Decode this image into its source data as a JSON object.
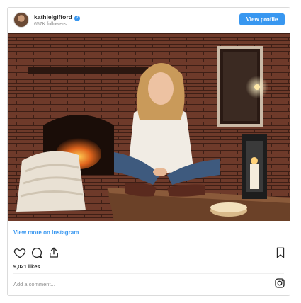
{
  "header": {
    "username": "kathielgifford",
    "verified_mark": "✓",
    "followers": "657K followers",
    "view_profile_label": "View profile"
  },
  "post": {
    "view_more_label": "View more on Instagram",
    "likes": "9,021 likes",
    "comment_placeholder": "Add a comment..."
  },
  "icons": {
    "like": "heart-icon",
    "comment": "comment-icon",
    "share": "share-icon",
    "save": "bookmark-icon",
    "brand": "instagram-icon"
  },
  "colors": {
    "accent": "#3897f0",
    "muted": "#8e8e8e",
    "border": "#dbdbdb"
  }
}
